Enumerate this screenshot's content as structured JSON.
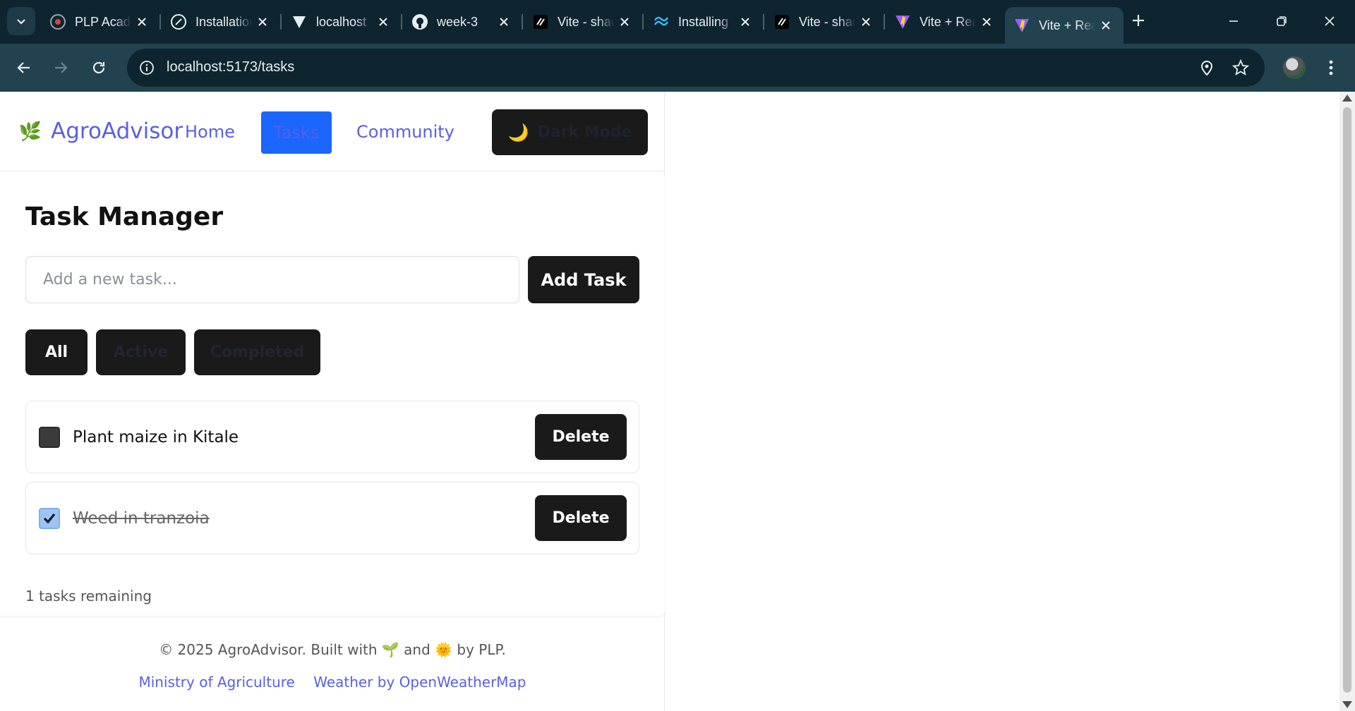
{
  "browser": {
    "tabs": [
      {
        "title": "PLP Academy",
        "icon": "plp-icon"
      },
      {
        "title": "Installation",
        "icon": "slash-icon"
      },
      {
        "title": "localhost",
        "icon": "vercel-icon"
      },
      {
        "title": "week-3",
        "icon": "github-icon"
      },
      {
        "title": "Vite - shadcn",
        "icon": "slash-icon"
      },
      {
        "title": "Installing",
        "icon": "tailwind-icon"
      },
      {
        "title": "Vite - shadcn",
        "icon": "slash-icon"
      },
      {
        "title": "Vite + React",
        "icon": "vite-icon"
      },
      {
        "title": "Vite + React",
        "icon": "vite-icon",
        "active": true
      }
    ],
    "url": "localhost:5173/tasks"
  },
  "nav": {
    "brand_icon": "🌿",
    "brand_name": "AgroAdvisor",
    "home_label": "Home",
    "tasks_label": "Tasks",
    "community_label": "Community",
    "dark_mode_icon": "🌙",
    "dark_mode_label": "Dark Mode"
  },
  "task_manager": {
    "title": "Task Manager",
    "input_placeholder": "Add a new task...",
    "add_label": "Add Task",
    "filters": {
      "all": "All",
      "active": "Active",
      "completed": "Completed"
    },
    "tasks": [
      {
        "text": "Plant maize in Kitale",
        "completed": false,
        "delete_label": "Delete"
      },
      {
        "text": "Weed in tranzoia",
        "completed": true,
        "delete_label": "Delete"
      }
    ],
    "remaining_text": "1 tasks remaining"
  },
  "footer": {
    "copyright_start": "© 2025 AgroAdvisor. Built with",
    "icon_sprout": "🌱",
    "and_text": "and",
    "icon_sun": "🌞",
    "by_text": "by PLP.",
    "link_ministry": "Ministry of Agriculture",
    "link_weather": "Weather by OpenWeatherMap"
  },
  "colors": {
    "accent": "#5b5fe0",
    "active_tab_bg": "#1a66ff",
    "button_bg": "#1a1a1a",
    "chrome_bg": "#0e2530",
    "toolbar_bg": "#22424f"
  }
}
